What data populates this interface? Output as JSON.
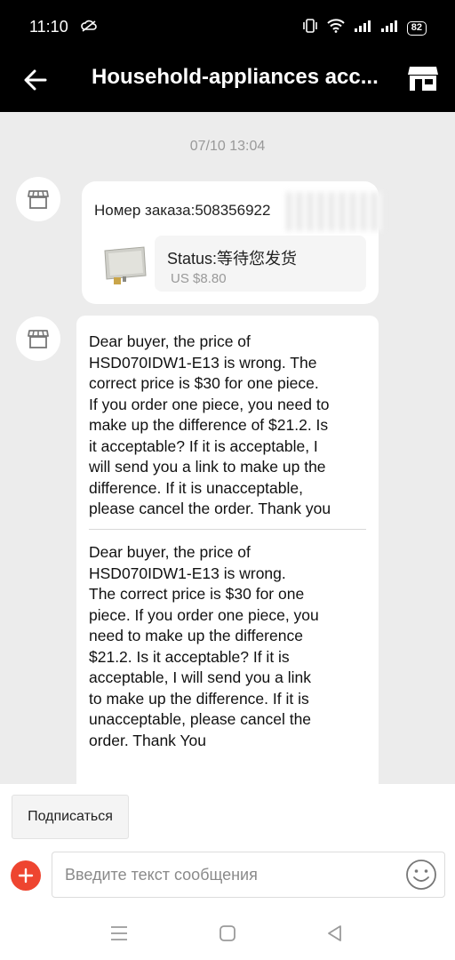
{
  "status_bar": {
    "time": "11:10",
    "battery": "82"
  },
  "header": {
    "title": "Household-appliances acc..."
  },
  "chat": {
    "timestamp": "07/10 13:04",
    "order_card": {
      "order_number": "Номер заказа:508356922",
      "status": "Status:等待您发货",
      "price": "US $8.80"
    },
    "message": {
      "paragraph_1": "Dear buyer, the price of\nHSD070IDW1-E13 is wrong. The\ncorrect price is $30 for one piece.\nIf you order one piece, you need to\nmake up the difference of $21.2. Is\nit acceptable? If it is acceptable, I\nwill send you a link to make up the\ndifference. If it is unacceptable,\nplease cancel the order. Thank you",
      "paragraph_2": "Dear buyer, the price of\nHSD070IDW1-E13 is wrong.\nThe correct price is $30 for one\npiece. If you order one piece, you\nneed to make up the difference\n$21.2. Is it acceptable? If it is\nacceptable, I will send you a link\n to make up the difference. If it is\nunacceptable, please cancel the\norder. Thank You"
    }
  },
  "bottom": {
    "subscribe_label": "Подписаться",
    "input_placeholder": "Введите текст сообщения"
  },
  "colors": {
    "accent_red": "#ee4530",
    "header_bg": "#000000",
    "chat_bg": "#ececec"
  },
  "icons": [
    "cloud-icon",
    "vibrate-icon",
    "wifi-icon",
    "signal-icon",
    "battery-icon",
    "back-arrow-icon",
    "store-icon",
    "shop-avatar-icon",
    "plus-icon",
    "emoji-icon",
    "menu-icon",
    "home-icon",
    "back-triangle-icon"
  ]
}
